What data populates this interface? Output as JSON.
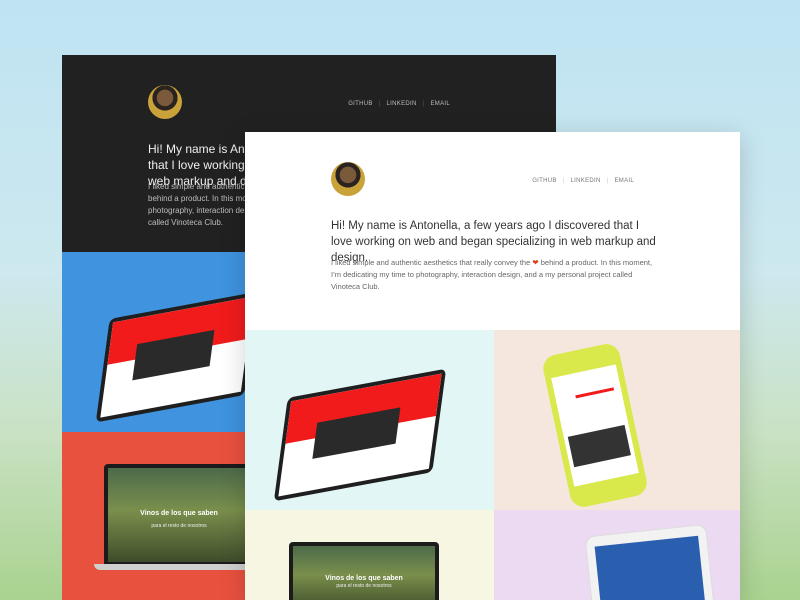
{
  "header": {
    "nav": [
      "GITHUB",
      "LINKEDIN",
      "EMAIL"
    ]
  },
  "back_card": {
    "intro": "Hi! My name is Antonella, a few years ago I discovered that I love working on web and began specializing in web markup and design.",
    "sub": "I liked simple and authentic aesthetics that really convey the ❤ behind a product. In this moment, I’m dedicating my time to photography, interaction design, and a my personal project called Vinoteca Club.",
    "laptop_caption": "Vinos de los que saben",
    "laptop_caption2": "para el resto de nosotros"
  },
  "front_card": {
    "intro": "Hi! My name is Antonella, a few years ago I discovered that I love working on web and began specializing in web markup and design.",
    "sub_before": "I liked simple and authentic aesthetics that really convey the",
    "heart": "❤",
    "sub_after": "behind a product. In this moment, I’m dedicating my time to photography, interaction design, and a my personal project called Vinoteca Club.",
    "laptop_caption": "Vinos de los que saben",
    "laptop_caption2": "para el resto de nosotros"
  },
  "colors": {
    "background_top": "#bfe3f2",
    "background_bottom": "#a9d28f",
    "dark_card": "#212121",
    "blue_tile": "#3f93df",
    "red_tile": "#e8513e",
    "mint_tile": "#e3f6f6",
    "peach_tile": "#f6e7de",
    "cream_tile": "#f6f6e2",
    "lilac_tile": "#ecd9f2",
    "accent_red": "#f11b1b"
  },
  "icons": [
    "avatar",
    "heart-icon"
  ]
}
